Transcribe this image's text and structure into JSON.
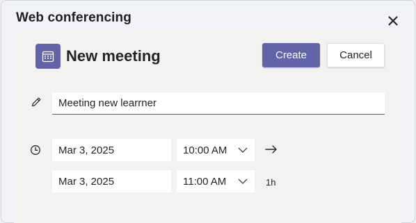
{
  "dialog": {
    "title": "Web conferencing"
  },
  "meeting": {
    "title": "New meeting",
    "create_label": "Create",
    "cancel_label": "Cancel",
    "title_input_value": "Meeting new learrner"
  },
  "schedule": {
    "start_date": "Mar 3, 2025",
    "start_time": "10:00 AM",
    "end_date": "Mar 3, 2025",
    "end_time": "11:00 AM",
    "duration": "1h"
  },
  "colors": {
    "accent": "#6264a7",
    "panel": "#f3f2f1",
    "background": "#eef0f6"
  },
  "icons": [
    "close-icon",
    "calendar-icon",
    "pencil-icon",
    "clock-icon",
    "chevron-down-icon",
    "arrow-right-icon"
  ]
}
